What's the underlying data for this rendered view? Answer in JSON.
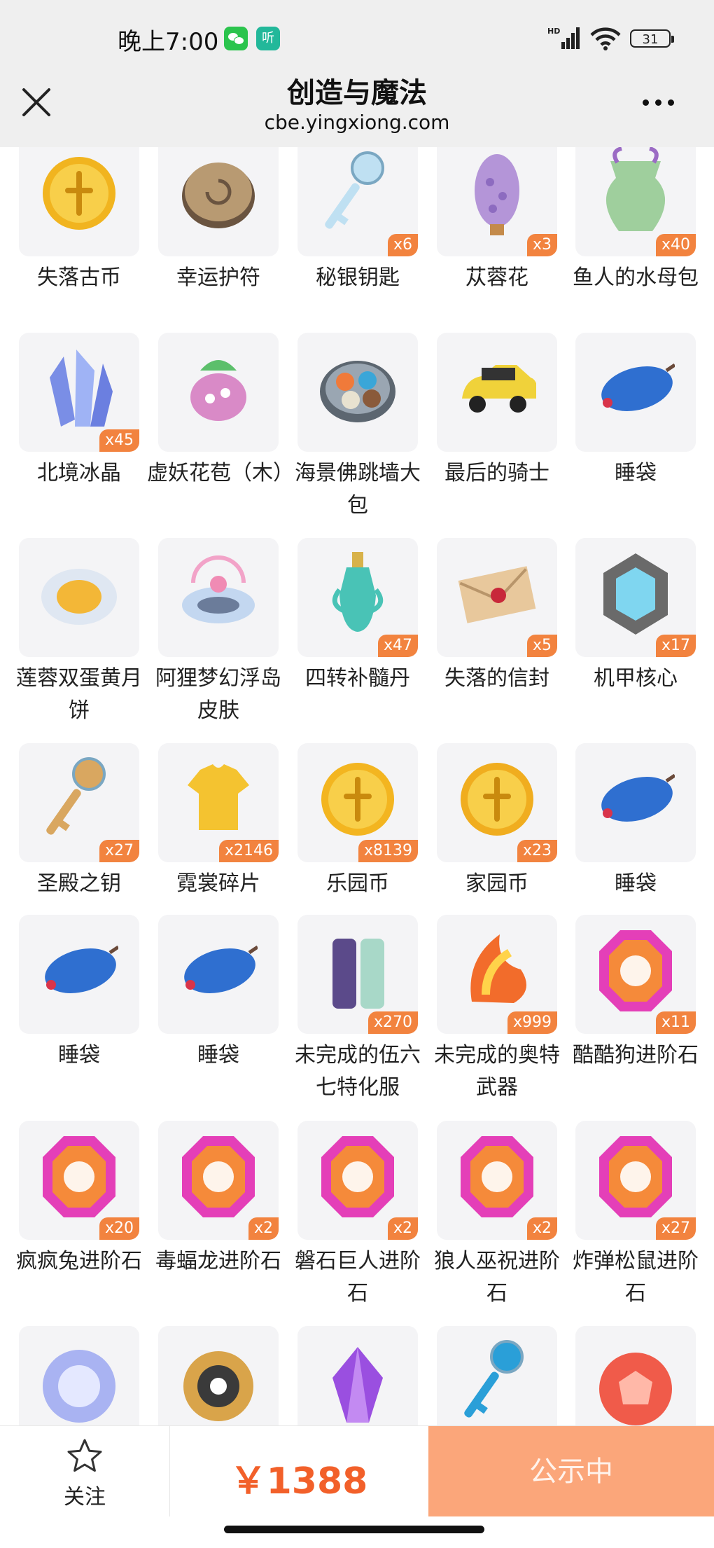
{
  "status_bar": {
    "time": "晚上7:00",
    "notif_app": "听",
    "network": "HD",
    "battery": "31"
  },
  "nav": {
    "title": "创造与魔法",
    "subtitle": "cbe.yingxiong.com"
  },
  "items": [
    {
      "name": "失落古币",
      "badge": "",
      "icon": "ankh-gold-coin-icon",
      "color": "#f1b41f"
    },
    {
      "name": "幸运护符",
      "badge": "",
      "icon": "stone-charm-icon",
      "color": "#b89a72"
    },
    {
      "name": "秘银钥匙",
      "badge": "x6",
      "icon": "silver-key-icon",
      "color": "#bfe0f2"
    },
    {
      "name": "苁蓉花",
      "badge": "x3",
      "icon": "purple-flower-icon",
      "color": "#b495d8"
    },
    {
      "name": "鱼人的水母包",
      "badge": "x40",
      "icon": "jellyfish-bag-icon",
      "color": "#9fcf9d"
    },
    {
      "name": "北境冰晶",
      "badge": "x45",
      "icon": "ice-crystal-icon",
      "color": "#7a8ee6"
    },
    {
      "name": "虚妖花苞（木）",
      "badge": "",
      "icon": "flower-bud-icon",
      "color": "#d98ac7"
    },
    {
      "name": "海景佛跳墙大包",
      "badge": "",
      "icon": "food-platter-icon",
      "color": "#7f8fa0"
    },
    {
      "name": "最后的骑士",
      "badge": "",
      "icon": "yellow-car-icon",
      "color": "#f0d23a"
    },
    {
      "name": "睡袋",
      "badge": "",
      "icon": "sleeping-bag-icon",
      "color": "#2f6fd0"
    },
    {
      "name": "莲蓉双蛋黄月饼",
      "badge": "",
      "icon": "mooncake-icon",
      "color": "#f3b737"
    },
    {
      "name": "阿狸梦幻浮岛皮肤",
      "badge": "",
      "icon": "floating-island-icon",
      "color": "#c3d7f0"
    },
    {
      "name": "四转补髓丹",
      "badge": "x47",
      "icon": "potion-bottle-icon",
      "color": "#49c3b6"
    },
    {
      "name": "失落的信封",
      "badge": "x5",
      "icon": "envelope-icon",
      "color": "#e8c89c"
    },
    {
      "name": "机甲核心",
      "badge": "x17",
      "icon": "mech-core-icon",
      "color": "#6a6a6a"
    },
    {
      "name": "圣殿之钥",
      "badge": "x27",
      "icon": "temple-key-icon",
      "color": "#d9a760"
    },
    {
      "name": "霓裳碎片",
      "badge": "x2146",
      "icon": "shirt-icon",
      "color": "#f4c330"
    },
    {
      "name": "乐园币",
      "badge": "x8139",
      "icon": "park-coin-icon",
      "color": "#f3b520"
    },
    {
      "name": "家园币",
      "badge": "x23",
      "icon": "home-coin-icon",
      "color": "#f0ad1f"
    },
    {
      "name": "睡袋",
      "badge": "",
      "icon": "sleeping-bag-icon",
      "color": "#2f6fd0"
    },
    {
      "name": "睡袋",
      "badge": "",
      "icon": "sleeping-bag-icon",
      "color": "#2f6fd0"
    },
    {
      "name": "睡袋",
      "badge": "",
      "icon": "sleeping-bag-icon",
      "color": "#2f6fd0"
    },
    {
      "name": "未完成的伍六七特化服",
      "badge": "x270",
      "icon": "costume-icon",
      "color": "#5b4a8a"
    },
    {
      "name": "未完成的奥特武器",
      "badge": "x999",
      "icon": "flame-weapon-icon",
      "color": "#f26c2b"
    },
    {
      "name": "酷酷狗进阶石",
      "badge": "x11",
      "icon": "evolution-stone-icon",
      "color": "#e43fb8"
    },
    {
      "name": "疯疯兔进阶石",
      "badge": "x20",
      "icon": "evolution-stone-icon",
      "color": "#e43fb8"
    },
    {
      "name": "毒蝠龙进阶石",
      "badge": "x2",
      "icon": "evolution-stone-icon",
      "color": "#e43fb8"
    },
    {
      "name": "磐石巨人进阶石",
      "badge": "x2",
      "icon": "evolution-stone-icon",
      "color": "#e43fb8"
    },
    {
      "name": "狼人巫祝进阶石",
      "badge": "x2",
      "icon": "evolution-stone-icon",
      "color": "#e43fb8"
    },
    {
      "name": "炸弹松鼠进阶石",
      "badge": "x27",
      "icon": "evolution-stone-icon",
      "color": "#e43fb8"
    },
    {
      "name": "",
      "badge": "",
      "icon": "light-orb-icon",
      "color": "#a9b3f2"
    },
    {
      "name": "",
      "badge": "",
      "icon": "dark-sun-icon",
      "color": "#3a3a3a"
    },
    {
      "name": "",
      "badge": "",
      "icon": "purple-gem-icon",
      "color": "#9a4fe0"
    },
    {
      "name": "",
      "badge": "",
      "icon": "blue-key-icon",
      "color": "#2a9fd8"
    },
    {
      "name": "",
      "badge": "",
      "icon": "red-gem-coin-icon",
      "color": "#f05b4a"
    }
  ],
  "bottom": {
    "follow_label": "关注",
    "price": "￥1388",
    "action_label": "公示中"
  }
}
